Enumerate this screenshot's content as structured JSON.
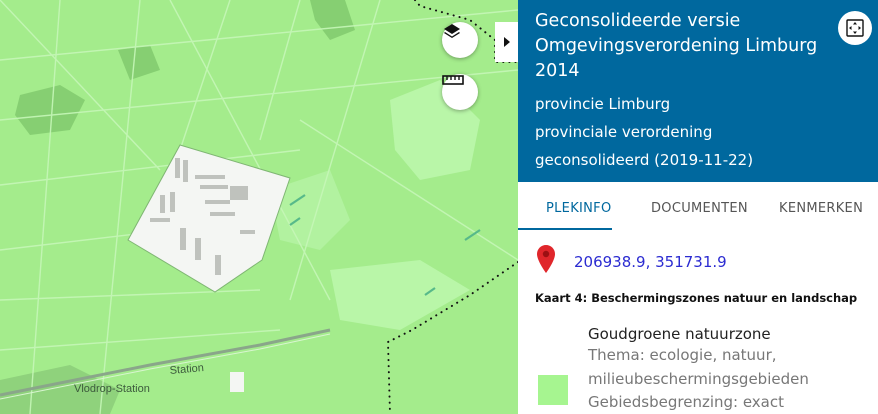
{
  "map": {
    "labels": {
      "station": "Station",
      "vlodrop": "Vlodrop-Station"
    },
    "colors": {
      "base": "#a4ec8c",
      "lighter": "#b6f6a4",
      "forest": "#7ec469",
      "water": "#5bbf8a",
      "built": "#ffffff",
      "rail": "#88a88a"
    },
    "controls": {
      "layers_icon": "layers-icon",
      "measure_icon": "ruler-icon",
      "collapse_icon": "chevron-right-icon"
    }
  },
  "panel": {
    "title": "Geconsolideerde versie Omgevingsverordening Limburg 2014",
    "meta": [
      "provincie Limburg",
      "provinciale verordening",
      "geconsolideerd (2019-11-22)"
    ],
    "fullscreen_icon": "expand-icon",
    "tabs": [
      {
        "label": "PLEKINFO",
        "active": true
      },
      {
        "label": "DOCUMENTEN",
        "active": false
      },
      {
        "label": "KENMERKEN",
        "active": false
      }
    ],
    "location": {
      "coords": "206938.9, 351731.9",
      "icon": "map-pin-icon"
    },
    "kaart_title": "Kaart 4: Beschermingszones natuur en landschap",
    "legend": {
      "swatch_color": "#a6f590",
      "name": "Goudgroene natuurzone",
      "thema_line1": "Thema: ecologie, natuur,",
      "thema_line2": "milieubeschermingsgebieden",
      "begrenzing": "Gebiedsbegrenzing: exact"
    },
    "header_color": "#00689e"
  }
}
